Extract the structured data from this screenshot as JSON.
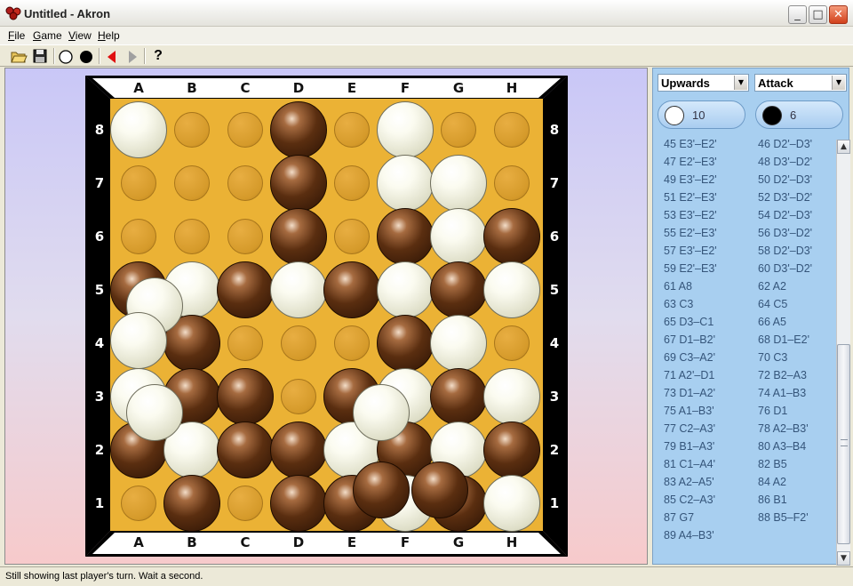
{
  "window": {
    "title": "Untitled - Akron",
    "minimize": "_",
    "maximize": "□",
    "close": "✕"
  },
  "menu": {
    "items": [
      {
        "key": "F",
        "rest": "ile"
      },
      {
        "key": "G",
        "rest": "ame"
      },
      {
        "key": "V",
        "rest": "iew"
      },
      {
        "key": "H",
        "rest": "elp"
      }
    ]
  },
  "toolbar": {
    "buttons": [
      "open-folder-icon",
      "save-disk-icon",
      "white-stone-icon",
      "black-stone-icon",
      "back-arrow-icon",
      "forward-arrow-icon",
      "help-icon"
    ],
    "help_glyph": "?"
  },
  "board": {
    "columns": [
      "A",
      "B",
      "C",
      "D",
      "E",
      "F",
      "G",
      "H"
    ],
    "rows": [
      "8",
      "7",
      "6",
      "5",
      "4",
      "3",
      "2",
      "1"
    ],
    "colors": {
      "frame": "#000000",
      "wood": "#ebb235",
      "white_ball": "#f6f6ea",
      "black_ball": "#5a2e10"
    },
    "grid": [
      [
        "W",
        null,
        null,
        "B",
        null,
        "W",
        null,
        null
      ],
      [
        null,
        null,
        null,
        "B",
        null,
        "W",
        "W",
        null
      ],
      [
        null,
        null,
        null,
        "B",
        null,
        "B",
        "W",
        "B"
      ],
      [
        "B",
        "W",
        "B",
        "W",
        "B",
        "W",
        "B",
        "W"
      ],
      [
        null,
        "B",
        null,
        null,
        null,
        "B",
        "W",
        null
      ],
      [
        "W",
        "B",
        "B",
        null,
        "B",
        "W",
        "B",
        "W"
      ],
      [
        "B",
        "W",
        "B",
        "B",
        "W",
        "B",
        "W",
        "B"
      ],
      [
        null,
        "B",
        null,
        "B",
        "B",
        "W",
        "B",
        "W"
      ]
    ],
    "raised": [
      {
        "color": "W",
        "col": 0.3,
        "row": 3.3
      },
      {
        "color": "W",
        "col": 0.0,
        "row": 3.95
      },
      {
        "color": "W",
        "col": 0.3,
        "row": 5.3
      },
      {
        "color": "W",
        "col": 4.55,
        "row": 5.3
      },
      {
        "color": "B",
        "col": 4.55,
        "row": 6.75
      },
      {
        "color": "B",
        "col": 5.65,
        "row": 6.75
      }
    ]
  },
  "panel": {
    "direction_select": "Upwards",
    "mode_select": "Attack",
    "dropdown_glyph": "▼",
    "white_count": "10",
    "black_count": "6",
    "moves": [
      [
        "45 E3'–E2'",
        "46 D2'–D3'"
      ],
      [
        "47 E2'–E3'",
        "48 D3'–D2'"
      ],
      [
        "49 E3'–E2'",
        "50 D2'–D3'"
      ],
      [
        "51 E2'–E3'",
        "52 D3'–D2'"
      ],
      [
        "53 E3'–E2'",
        "54 D2'–D3'"
      ],
      [
        "55 E2'–E3'",
        "56 D3'–D2'"
      ],
      [
        "57 E3'–E2'",
        "58 D2'–D3'"
      ],
      [
        "59 E2'–E3'",
        "60 D3'–D2'"
      ],
      [
        "61 A8",
        "62 A2"
      ],
      [
        "63 C3",
        "64 C5"
      ],
      [
        "65 D3–C1",
        "66 A5"
      ],
      [
        "67 D1–B2'",
        "68 D1–E2'"
      ],
      [
        "69 C3–A2'",
        "70 C3"
      ],
      [
        "71 A2'–D1",
        "72 B2–A3"
      ],
      [
        "73 D1–A2'",
        "74 A1–B3"
      ],
      [
        "75 A1–B3'",
        "76 D1"
      ],
      [
        "77 C2–A3'",
        "78 A2–B3'"
      ],
      [
        "79 B1–A3'",
        "80 A3–B4"
      ],
      [
        "81 C1–A4'",
        "82 B5"
      ],
      [
        "83 A2–A5'",
        "84 A2"
      ],
      [
        "85 C2–A3'",
        "86 B1"
      ],
      [
        "87 G7",
        "88 B5–F2'"
      ],
      [
        "89 A4–B3'",
        ""
      ]
    ],
    "scroll_up": "▲",
    "scroll_down": "▼"
  },
  "status": {
    "text": "Still showing last player's turn. Wait a second."
  }
}
